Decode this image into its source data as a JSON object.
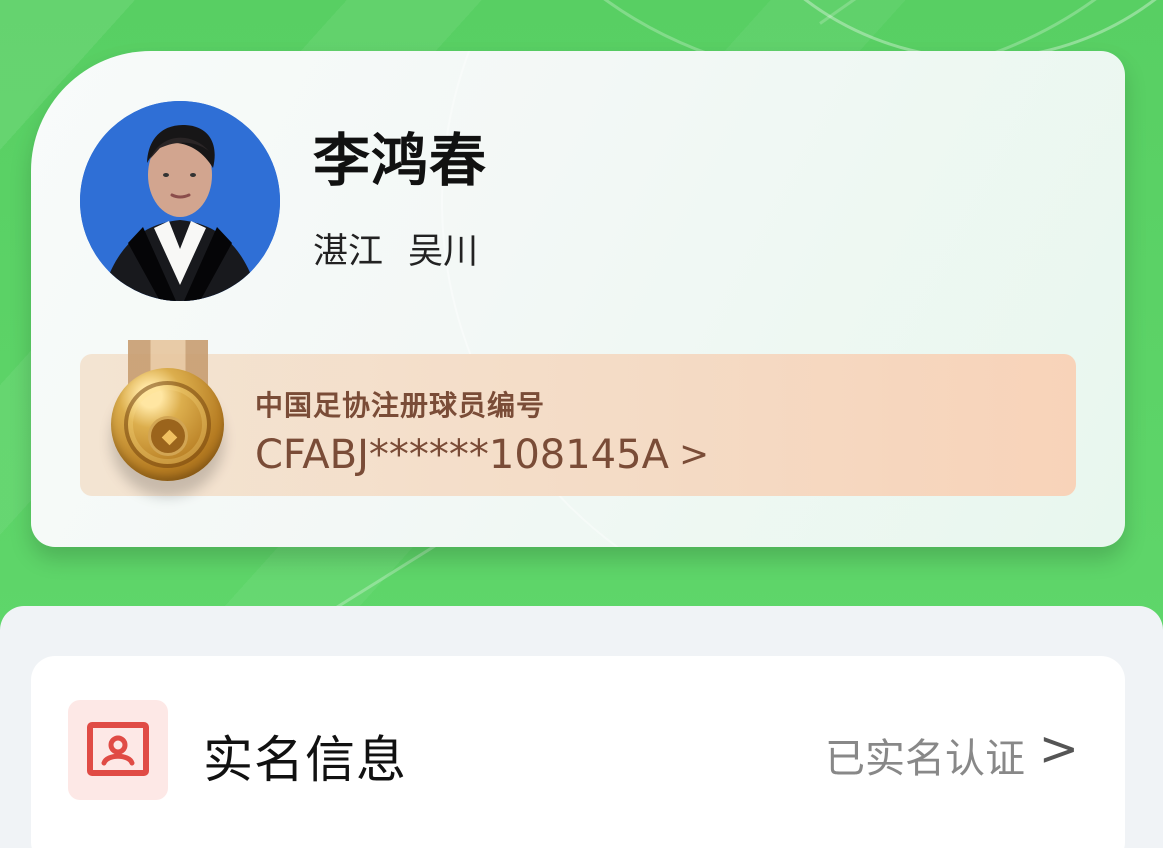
{
  "profile": {
    "name": "李鸿春",
    "location": {
      "city": "湛江",
      "district": "吴川"
    },
    "avatar_alt": "player-avatar",
    "colors": {
      "background_green": "#5ed66a",
      "card_white": "#f8fbfa",
      "avatar_blue": "#2f6fd6"
    }
  },
  "registration": {
    "label": "中国足协注册球员编号",
    "number": "CFABJ******108145A",
    "chevron": ">",
    "icon": "medal-icon",
    "colors": {
      "panel_start": "#f3e4d2",
      "panel_end": "#f8d3b9",
      "text": "#7a4c37"
    }
  },
  "identity_section": {
    "title": "实名信息",
    "status": "已实名认证",
    "chevron": ">",
    "icon": "id-card-icon",
    "colors": {
      "icon_background": "#fde8e6",
      "icon_stroke": "#e04b45",
      "status_text": "#888888"
    }
  }
}
